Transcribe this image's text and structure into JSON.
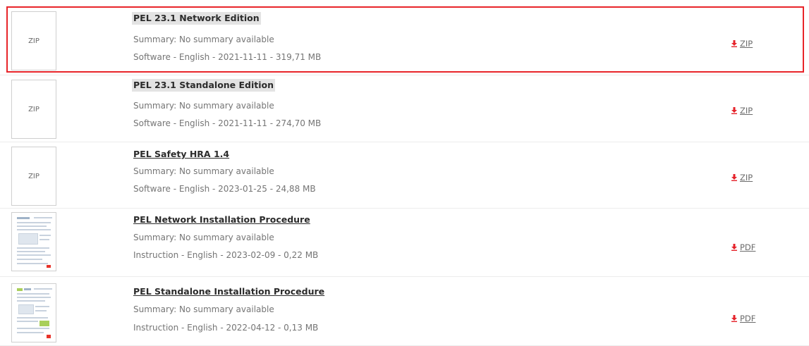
{
  "downloads": {
    "items": [
      {
        "thumb_label": "ZIP",
        "title": "PEL 23.1 Network Edition",
        "summary": "Summary: No summary available",
        "meta": "Software - English - 2021-11-11 - 319,71 MB",
        "download_label": "ZIP",
        "selected": true
      },
      {
        "thumb_label": "ZIP",
        "title": "PEL 23.1 Standalone Edition",
        "summary": "Summary: No summary available",
        "meta": "Software - English - 2021-11-11 - 274,70 MB",
        "download_label": "ZIP",
        "selected": false
      },
      {
        "thumb_label": "ZIP",
        "title": "PEL Safety HRA 1.4",
        "summary": "Summary: No summary available",
        "meta": "Software - English - 2023-01-25 - 24,88 MB",
        "download_label": "ZIP",
        "selected": false
      },
      {
        "thumb_label": "",
        "title": "PEL Network Installation Procedure",
        "summary": "Summary: No summary available",
        "meta": "Instruction - English - 2023-02-09 - 0,22 MB",
        "download_label": "PDF",
        "selected": false
      },
      {
        "thumb_label": "",
        "title": "PEL Standalone Installation Procedure",
        "summary": "Summary: No summary available",
        "meta": "Instruction - English - 2022-04-12 - 0,13 MB",
        "download_label": "PDF",
        "selected": false
      }
    ]
  },
  "icons": {
    "download": "download-arrow-icon",
    "zip_thumbnail": "zip-file-thumbnail-icon",
    "pdf_thumbnail": "pdf-document-thumbnail-icon"
  },
  "colors": {
    "selection_border": "#e8252a",
    "download_arrow": "#e5222a",
    "title_text": "#2b2b2b",
    "secondary_text": "#757575"
  }
}
